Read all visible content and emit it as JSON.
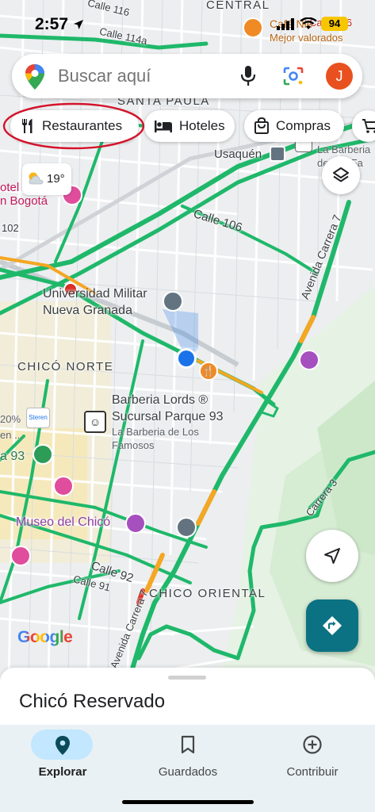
{
  "status_bar": {
    "time": "2:57",
    "battery": "94",
    "icons": [
      "location-arrow-icon",
      "signal-icon",
      "wifi-icon",
      "battery-icon"
    ]
  },
  "search": {
    "placeholder": "Buscar aquí",
    "avatar_initial": "J",
    "icons": [
      "maps-pin-logo",
      "microphone-icon",
      "lens-icon"
    ]
  },
  "chips": [
    {
      "label": "Restaurantes",
      "icon": "fork-knife-icon"
    },
    {
      "label": "Hoteles",
      "icon": "bed-icon"
    },
    {
      "label": "Compras",
      "icon": "shopping-bag-icon"
    }
  ],
  "weather": {
    "temp": "19°",
    "icon": "partly-cloudy-icon"
  },
  "map": {
    "areas": [
      "SANTA PAULA",
      "CHICÓ NORTE",
      "CHICO ORIENTAL",
      "CENTRAL"
    ],
    "streets": [
      "Calle 116",
      "Calle 114a",
      "Calle 106",
      "Avenida Carrera 7",
      "Calle 92",
      "Calle 91",
      "Avenida Carrera 7",
      "Carrera 3",
      "Calle 116",
      "102"
    ],
    "pois": {
      "usaquen": "Usaquén",
      "univ_line1": "Universidad Militar",
      "univ_line2": "Nueva Granada",
      "barberia_line1": "Barberia Lords",
      "barberia_line2": "Sucursal Parque 93",
      "barberia_sub1": "La Barberia de Los",
      "barberia_sub2": "Famosos",
      "museo": "Museo del Chicó",
      "hotel_line1": "otel",
      "hotel_line2": "n Bogotá",
      "la_barberia_1": "La Barberia",
      "la_barberia_2": "de Los Fa",
      "restaurant_top_1": "Café Nie",
      "restaurant_top_2": "Mejor valorados",
      "steren": "Steren",
      "pct": "20%",
      "en": "en ...",
      "a93": "a 93"
    },
    "google_logo": "Google"
  },
  "sheet": {
    "title": "Chicó Reservado"
  },
  "nav": [
    {
      "label": "Explorar",
      "icon": "explore-pin-icon",
      "active": true
    },
    {
      "label": "Guardados",
      "icon": "bookmark-icon",
      "active": false
    },
    {
      "label": "Contribuir",
      "icon": "add-circle-icon",
      "active": false
    }
  ],
  "colors": {
    "traffic_green": "#1fb86a",
    "traffic_orange": "#f5a623",
    "traffic_red": "#d93025",
    "location_blue": "#1a73e8",
    "directions_teal": "#0b7283",
    "annotation_red": "#d3132a"
  }
}
